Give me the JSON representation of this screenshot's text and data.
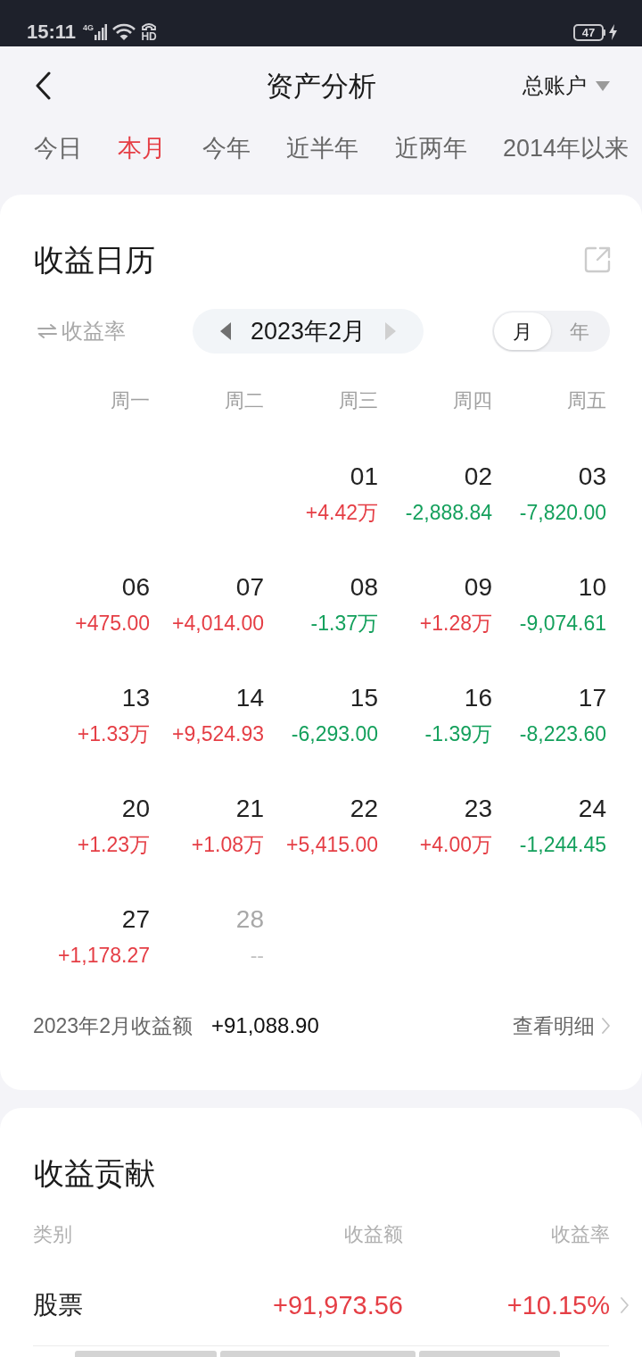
{
  "status_bar": {
    "time": "15:11",
    "network": "4G",
    "call_badge": "HD",
    "battery": "47",
    "charging": true
  },
  "header": {
    "title": "资产分析",
    "account": "总账户"
  },
  "period_tabs": [
    {
      "label": "今日",
      "selected": false
    },
    {
      "label": "本月",
      "selected": true
    },
    {
      "label": "今年",
      "selected": false
    },
    {
      "label": "近半年",
      "selected": false
    },
    {
      "label": "近两年",
      "selected": false
    },
    {
      "label": "2014年以来",
      "selected": false
    }
  ],
  "calendar": {
    "title": "收益日历",
    "metric_toggle": "收益率",
    "month": "2023年2月",
    "next_disabled": true,
    "view_options": [
      {
        "label": "月",
        "selected": true
      },
      {
        "label": "年",
        "selected": false
      }
    ],
    "weekdays": [
      "周一",
      "周二",
      "周三",
      "周四",
      "周五"
    ],
    "weeks": [
      {
        "days": [
          {
            "kind": "blank"
          },
          {
            "kind": "blank"
          },
          {
            "kind": "day",
            "date": "01",
            "value": "+4.42万",
            "color": "#e53e45",
            "disabled": false
          },
          {
            "kind": "day",
            "date": "02",
            "value": "-2,888.84",
            "color": "#14a05c",
            "disabled": false
          },
          {
            "kind": "day",
            "date": "03",
            "value": "-7,820.00",
            "color": "#14a05c",
            "disabled": false
          }
        ]
      },
      {
        "days": [
          {
            "kind": "day",
            "date": "06",
            "value": "+475.00",
            "color": "#e53e45",
            "disabled": false
          },
          {
            "kind": "day",
            "date": "07",
            "value": "+4,014.00",
            "color": "#e53e45",
            "disabled": false
          },
          {
            "kind": "day",
            "date": "08",
            "value": "-1.37万",
            "color": "#14a05c",
            "disabled": false
          },
          {
            "kind": "day",
            "date": "09",
            "value": "+1.28万",
            "color": "#e53e45",
            "disabled": false
          },
          {
            "kind": "day",
            "date": "10",
            "value": "-9,074.61",
            "color": "#14a05c",
            "disabled": false
          }
        ]
      },
      {
        "days": [
          {
            "kind": "day",
            "date": "13",
            "value": "+1.33万",
            "color": "#e53e45",
            "disabled": false
          },
          {
            "kind": "day",
            "date": "14",
            "value": "+9,524.93",
            "color": "#e53e45",
            "disabled": false
          },
          {
            "kind": "day",
            "date": "15",
            "value": "-6,293.00",
            "color": "#14a05c",
            "disabled": false
          },
          {
            "kind": "day",
            "date": "16",
            "value": "-1.39万",
            "color": "#14a05c",
            "disabled": false
          },
          {
            "kind": "day",
            "date": "17",
            "value": "-8,223.60",
            "color": "#14a05c",
            "disabled": false
          }
        ]
      },
      {
        "days": [
          {
            "kind": "day",
            "date": "20",
            "value": "+1.23万",
            "color": "#e53e45",
            "disabled": false
          },
          {
            "kind": "day",
            "date": "21",
            "value": "+1.08万",
            "color": "#e53e45",
            "disabled": false
          },
          {
            "kind": "day",
            "date": "22",
            "value": "+5,415.00",
            "color": "#e53e45",
            "disabled": false
          },
          {
            "kind": "day",
            "date": "23",
            "value": "+4.00万",
            "color": "#e53e45",
            "disabled": false
          },
          {
            "kind": "day",
            "date": "24",
            "value": "-1,244.45",
            "color": "#14a05c",
            "disabled": false
          }
        ]
      },
      {
        "days": [
          {
            "kind": "day",
            "date": "27",
            "value": "+1,178.27",
            "color": "#e53e45",
            "disabled": false
          },
          {
            "kind": "day",
            "date": "28",
            "value": "--",
            "color": "#c4c4c4",
            "disabled": true
          }
        ]
      }
    ],
    "summary": {
      "label": "2023年2月收益额",
      "value": "+91,088.90",
      "link": "查看明细"
    }
  },
  "contribution": {
    "title": "收益贡献",
    "columns": [
      "类别",
      "收益额",
      "收益率"
    ],
    "rows": [
      {
        "category": "股票",
        "amount": "+91,973.56",
        "rate": "+10.15%"
      }
    ]
  }
}
